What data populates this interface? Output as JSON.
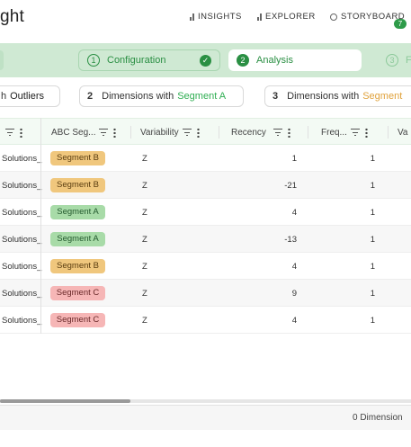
{
  "app": {
    "logo_text": "ght"
  },
  "topnav": [
    {
      "label": "INSIGHTS",
      "icon": "bar-chart-icon"
    },
    {
      "label": "EXPLORER",
      "icon": "bar-chart-icon"
    },
    {
      "label": "STORYBOARD",
      "icon": "storyboard-icon",
      "badge": "7"
    }
  ],
  "stepper": {
    "steps": [
      {
        "num": "1",
        "label": "Configuration",
        "state": "done"
      },
      {
        "num": "2",
        "label": "Analysis",
        "state": "active"
      },
      {
        "num": "3",
        "label": "F",
        "state": "pending"
      }
    ]
  },
  "chips": [
    {
      "prefix": "h",
      "label": "Outliers"
    },
    {
      "num": "2",
      "text": "Dimensions with",
      "highlight": "Segment A",
      "highlight_color": "#2fae52"
    },
    {
      "num": "3",
      "text": "Dimensions with",
      "highlight": "Segment",
      "highlight_color": "#e0a23c"
    }
  ],
  "table": {
    "columns": [
      "ABC Seg...",
      "Variability",
      "Recency",
      "Freq...",
      "Va"
    ],
    "rows": [
      {
        "name": "Solutions_",
        "abc": "Segment B",
        "abc_class": "B",
        "variability": "Z",
        "recency": "1",
        "frequency": "1"
      },
      {
        "name": "Solutions_",
        "abc": "Segment B",
        "abc_class": "B",
        "variability": "Z",
        "recency": "-21",
        "frequency": "1"
      },
      {
        "name": "Solutions_",
        "abc": "Segment A",
        "abc_class": "A",
        "variability": "Z",
        "recency": "4",
        "frequency": "1"
      },
      {
        "name": "Solutions_",
        "abc": "Segment A",
        "abc_class": "A",
        "variability": "Z",
        "recency": "-13",
        "frequency": "1"
      },
      {
        "name": "Solutions_",
        "abc": "Segment B",
        "abc_class": "B",
        "variability": "Z",
        "recency": "4",
        "frequency": "1"
      },
      {
        "name": "Solutions_",
        "abc": "Segment C",
        "abc_class": "C",
        "variability": "Z",
        "recency": "9",
        "frequency": "1"
      },
      {
        "name": "Solutions_",
        "abc": "Segment C",
        "abc_class": "C",
        "variability": "Z",
        "recency": "4",
        "frequency": "1"
      }
    ]
  },
  "footer": {
    "text": "0   Dimension"
  },
  "colors": {
    "accent": "#2a8f43",
    "stepband": "#cfe9d3",
    "segment_a": "#a8dba8",
    "segment_b": "#f0c77d",
    "segment_c": "#f6b6b6"
  }
}
